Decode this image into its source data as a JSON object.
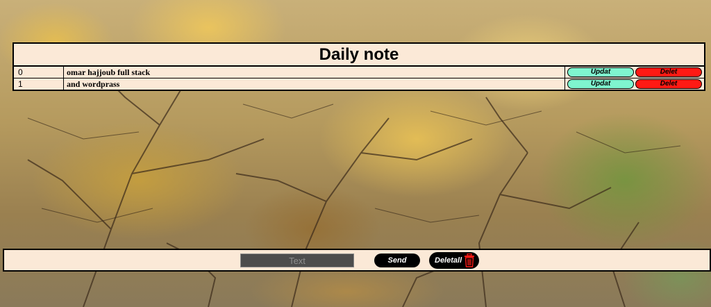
{
  "header": {
    "title": "Daily note"
  },
  "notes": [
    {
      "id": "0",
      "text": "omar hajjoub full stack",
      "update_label": "Updat",
      "delete_label": "Delet"
    },
    {
      "id": "1",
      "text": "and wordprass",
      "update_label": "Updat",
      "delete_label": "Delet"
    }
  ],
  "composer": {
    "input_placeholder": "Text",
    "input_value": "",
    "send_label": "Send",
    "delete_all_label": "Deletall",
    "delete_all_icon": "trash-icon"
  },
  "colors": {
    "panel_bg": "#fbe9d7",
    "update_button": "#7ff5cf",
    "delete_button": "#ff1a14",
    "dark_button": "#000000",
    "input_bg": "#4d4d4d",
    "trash_icon": "#ff1a14"
  }
}
